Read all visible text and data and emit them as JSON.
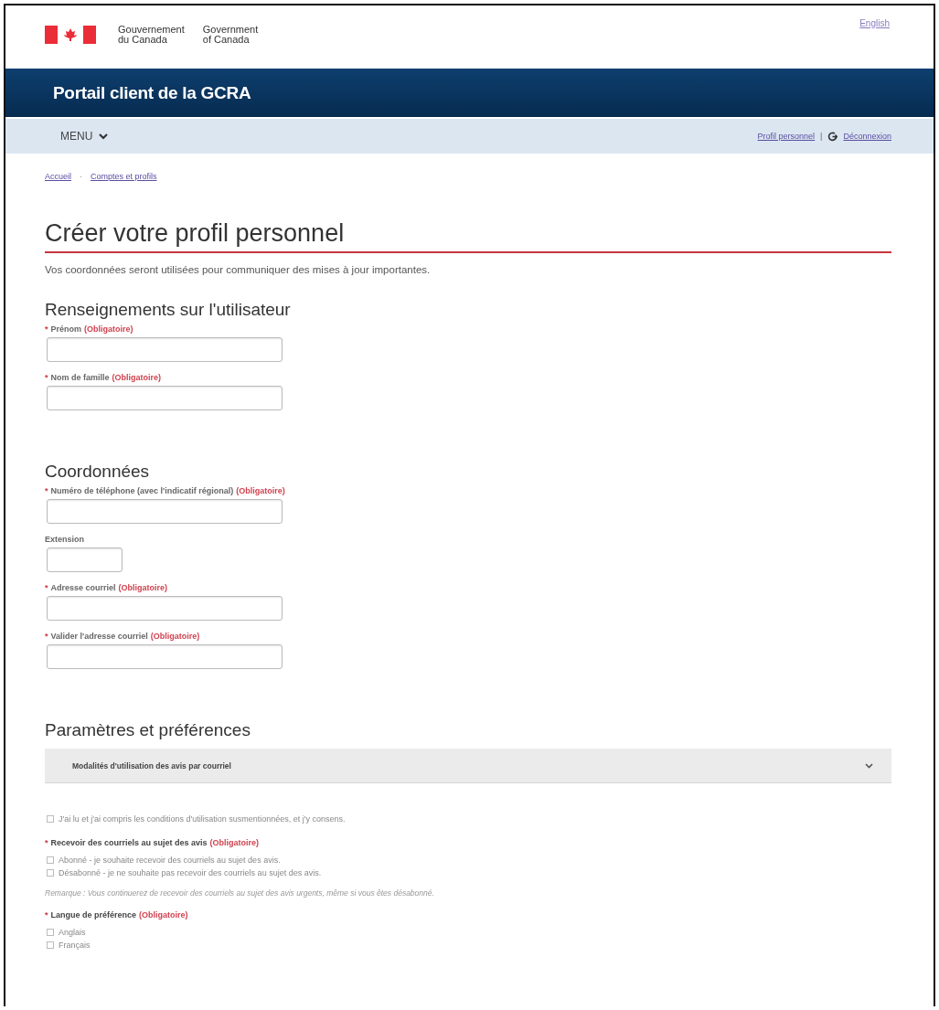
{
  "header": {
    "language_link": "English",
    "government_fr": [
      "Gouvernement",
      "du Canada"
    ],
    "government_en": [
      "Government",
      "of Canada"
    ]
  },
  "app_bar": {
    "title": "Portail client de la GCRA"
  },
  "menu_bar": {
    "menu": {
      "label": "MENU"
    },
    "profile_link": "Profil personnel",
    "separator": "|",
    "logout_link": "Déconnexion"
  },
  "breadcrumb": {
    "separator": "·",
    "items": [
      "Accueil",
      "Comptes et profils"
    ]
  },
  "page": {
    "title": "Créer votre profil personnel",
    "intro": "Vos coordonnées seront utilisées pour communiquer des mises à jour importantes."
  },
  "sections": [
    {
      "heading": "Renseignements sur l'utilisateur",
      "items": [
        {
          "kind": "text",
          "label": "Prénom",
          "required_mark": "*",
          "required_note": "(Obligatoire)"
        },
        {
          "kind": "text",
          "label": "Nom de famille",
          "required_mark": "*",
          "required_note": "(Obligatoire)"
        }
      ]
    },
    {
      "heading": "Coordonnées",
      "items": [
        {
          "kind": "text",
          "label": "Numéro de téléphone (avec l'indicatif régional)",
          "required_mark": "*",
          "required_note": "(Obligatoire)"
        },
        {
          "kind": "short_text",
          "label": "Extension"
        },
        {
          "kind": "text",
          "label": "Adresse courriel",
          "required_mark": "*",
          "required_note": "(Obligatoire)"
        },
        {
          "kind": "text",
          "label": "Valider l'adresse courriel",
          "required_mark": "*",
          "required_note": "(Obligatoire)"
        }
      ]
    },
    {
      "heading": "Paramètres et préférences",
      "items": [
        {
          "kind": "accordion",
          "label": "Modalités d'utilisation des avis par courriel",
          "expanded": false
        },
        {
          "kind": "checkbox",
          "label": "J'ai lu et j'ai compris les conditions d'utilisation susmentionnées, et j'y consens.",
          "checked": false
        },
        {
          "kind": "radio_group",
          "label": "Recevoir des courriels au sujet des avis",
          "required_mark": "*",
          "required_note": "(Obligatoire)",
          "options": [
            {
              "label": "Abonné - je souhaite recevoir des courriels au sujet des avis.",
              "selected": false
            },
            {
              "label": "Désabonné - je ne souhaite pas recevoir des courriels au sujet des avis.",
              "selected": false
            }
          ]
        },
        {
          "kind": "note",
          "text": "Remarque : Vous continuerez de recevoir des courriels au sujet des avis urgents, même si vous êtes désabonné."
        },
        {
          "kind": "radio_group",
          "label": "Langue de préférence",
          "required_mark": "*",
          "required_note": "(Obligatoire)",
          "options": [
            {
              "label": "Anglais",
              "selected": false
            },
            {
              "label": "Français",
              "selected": false
            }
          ]
        }
      ]
    }
  ]
}
